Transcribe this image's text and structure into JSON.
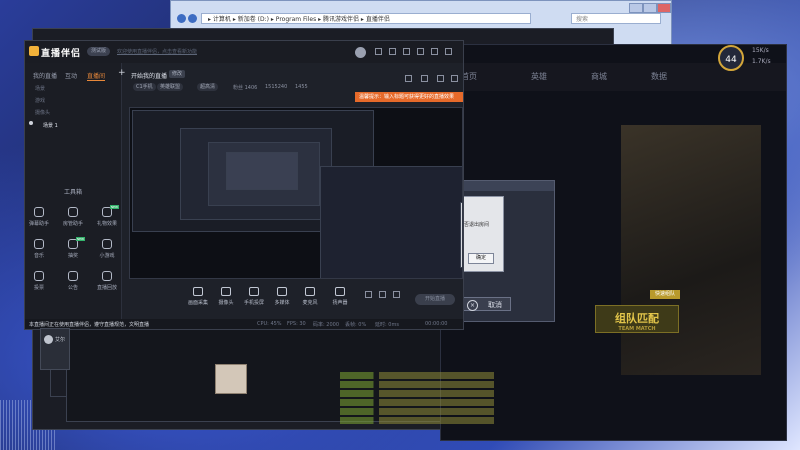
{
  "explorer": {
    "address": "▸ 计算机 ▸ 新加卷 (D:) ▸ Program Files ▸ 腾讯游戏伴侣 ▸ 直播伴侣",
    "search_placeholder": "搜索"
  },
  "game": {
    "nav": [
      "首页",
      "英雄",
      "商城",
      "数据"
    ],
    "team_button": "组队匹配",
    "team_button_sub": "TEAM MATCH",
    "badge": "快速组队",
    "cancel_label": "取消",
    "alert_message": "是否退出房间",
    "alert_ok": "确定"
  },
  "clock": {
    "value": "44",
    "up": "15K/s",
    "down": "1.7K/s"
  },
  "app": {
    "name": "直播伴侣",
    "version": "测试版",
    "notice": "欢迎使用直播伴侣，点击查看新功能",
    "sidebar": {
      "tabs": [
        "我的直播",
        "互动",
        "直播间"
      ],
      "active_tab": 2,
      "scenes": [
        "场景",
        "游戏",
        "摄像头",
        "场景 1"
      ],
      "tools_title": "工具箱",
      "tools": [
        {
          "label": "弹幕助手",
          "icon": "download-icon"
        },
        {
          "label": "房管助手",
          "icon": "user-icon"
        },
        {
          "label": "礼物效果",
          "icon": "gift-icon",
          "new": "NEW"
        },
        {
          "label": "音乐",
          "icon": "music-icon"
        },
        {
          "label": "抽奖",
          "icon": "prize-icon",
          "new": "NEW"
        },
        {
          "label": "小游戏",
          "icon": "game-icon"
        },
        {
          "label": "投票",
          "icon": "vote-icon"
        },
        {
          "label": "公告",
          "icon": "notice-icon"
        },
        {
          "label": "直播回放",
          "icon": "replay-icon"
        }
      ]
    },
    "stream_title": "开始我的直播",
    "edit_label": "修改",
    "chips": [
      "C1手机",
      "英雄联盟",
      "超高清"
    ],
    "stats": [
      "粉丝 1406",
      "1515240",
      "1455"
    ],
    "toast": "温馨提示：输入标题可获得更好的直播效果",
    "controls": [
      "画面采集",
      "摄像头",
      "手机投屏",
      "多媒体",
      "麦克风",
      "扬声器"
    ],
    "start_label": "开始直播",
    "bottom_message": "本直播间正在使用直播伴侣，遵守直播规范，文明直播",
    "bottom_stats": [
      "CPU: 45%",
      "FPS: 30",
      "码率: 2000",
      "丢帧: 0%",
      "延时: 0ms",
      "00:00:00"
    ]
  },
  "side_user": "艾尔",
  "colors": {
    "accent": "#e8883a",
    "toast": "#e66a2a",
    "gold": "#e2c54a"
  }
}
